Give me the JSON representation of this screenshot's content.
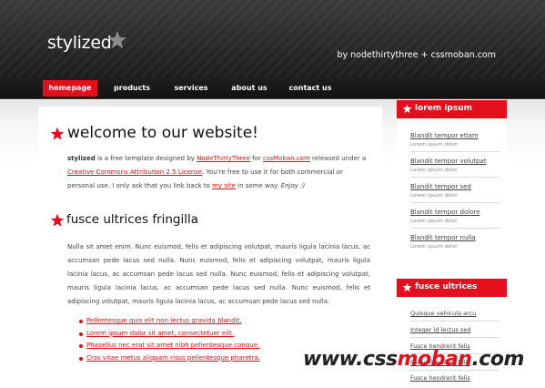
{
  "site": {
    "logo": "stylized",
    "tagline": "by nodethirtythree + cssmoban.com"
  },
  "nav": {
    "items": [
      {
        "label": "homepage",
        "active": true
      },
      {
        "label": "products",
        "active": false
      },
      {
        "label": "services",
        "active": false
      },
      {
        "label": "about us",
        "active": false
      },
      {
        "label": "contact us",
        "active": false
      }
    ]
  },
  "main": {
    "welcome_title": "welcome to our website!",
    "intro": {
      "brand": "stylized",
      "t1": " is a free template designed by ",
      "designer_link": "NodeThirtyThree",
      "t2": " for ",
      "cssmoban_link": "cssMoban.com",
      "t3": " released under a ",
      "license_link": "Creative Commons Attribution 2.5 License",
      "t4": ". You're free to use it for both commercial or personal use. I only ask that you link back to ",
      "mysite_link": "my site",
      "t5": " in some way. ",
      "enjoy": "Enjoy :)"
    },
    "section_title": "fusce ultrices fringilla",
    "body_text": "Nulla sit amet enim. Nunc euismod, felis et adipiscing volutpat, mauris ligula lacinia lacus, ac accumsan pede lacus sed nulla. Nunc euismod, felis et adipiscing volutpat, mauris ligula lacinia lacus, ac accumsan pede lacus sed nulla. Nunc euismod, felis et adipiscing volutpat, mauris ligula lacinia lacus, ac accumsan pede lacus sed nulla. Nunc euismod, felis et adipiscing volutpat, mauris ligula lacinia lacus, ac accumsan pede lacus sed nulla.",
    "bullets": [
      "Pellentesque quis elit non lectus gravida blandit.",
      "Lorem ipsum dolor sit amet, consectetuer elit.",
      "Phasellus nec erat sit amet nibh pellentesque congue.",
      "Cras vitae metus aliquam risus pellentesque pharetra."
    ]
  },
  "sidebar": {
    "box1_title": "lorem ipsum",
    "box1_items": [
      {
        "title": "Blandit tempor etiam",
        "sub": "Lorem ipsum dolor"
      },
      {
        "title": "Blandit tempor volutpat",
        "sub": "Lorem ipsum dolor"
      },
      {
        "title": "Blandit tempor sed",
        "sub": "Lorem ipsum dolor"
      },
      {
        "title": "Blandit tempor dolore",
        "sub": "Lorem ipsum dolor"
      },
      {
        "title": "Blandit tempor nulla",
        "sub": "Lorem ipsum dolor"
      }
    ],
    "box2_title": "fusce ultrices",
    "box2_items": [
      "Quisque vehicula arcu",
      "Integer id lectus sed",
      "Fusce hendrerit felis",
      "Fusce hendrerit felis",
      "Fusce hendrerit felis"
    ]
  },
  "watermark": {
    "part1": "www.css",
    "part2": "moban",
    "part3": ".com"
  },
  "colors": {
    "accent": "#e3101c",
    "header": "#2d2d2d",
    "nav": "#181818"
  }
}
